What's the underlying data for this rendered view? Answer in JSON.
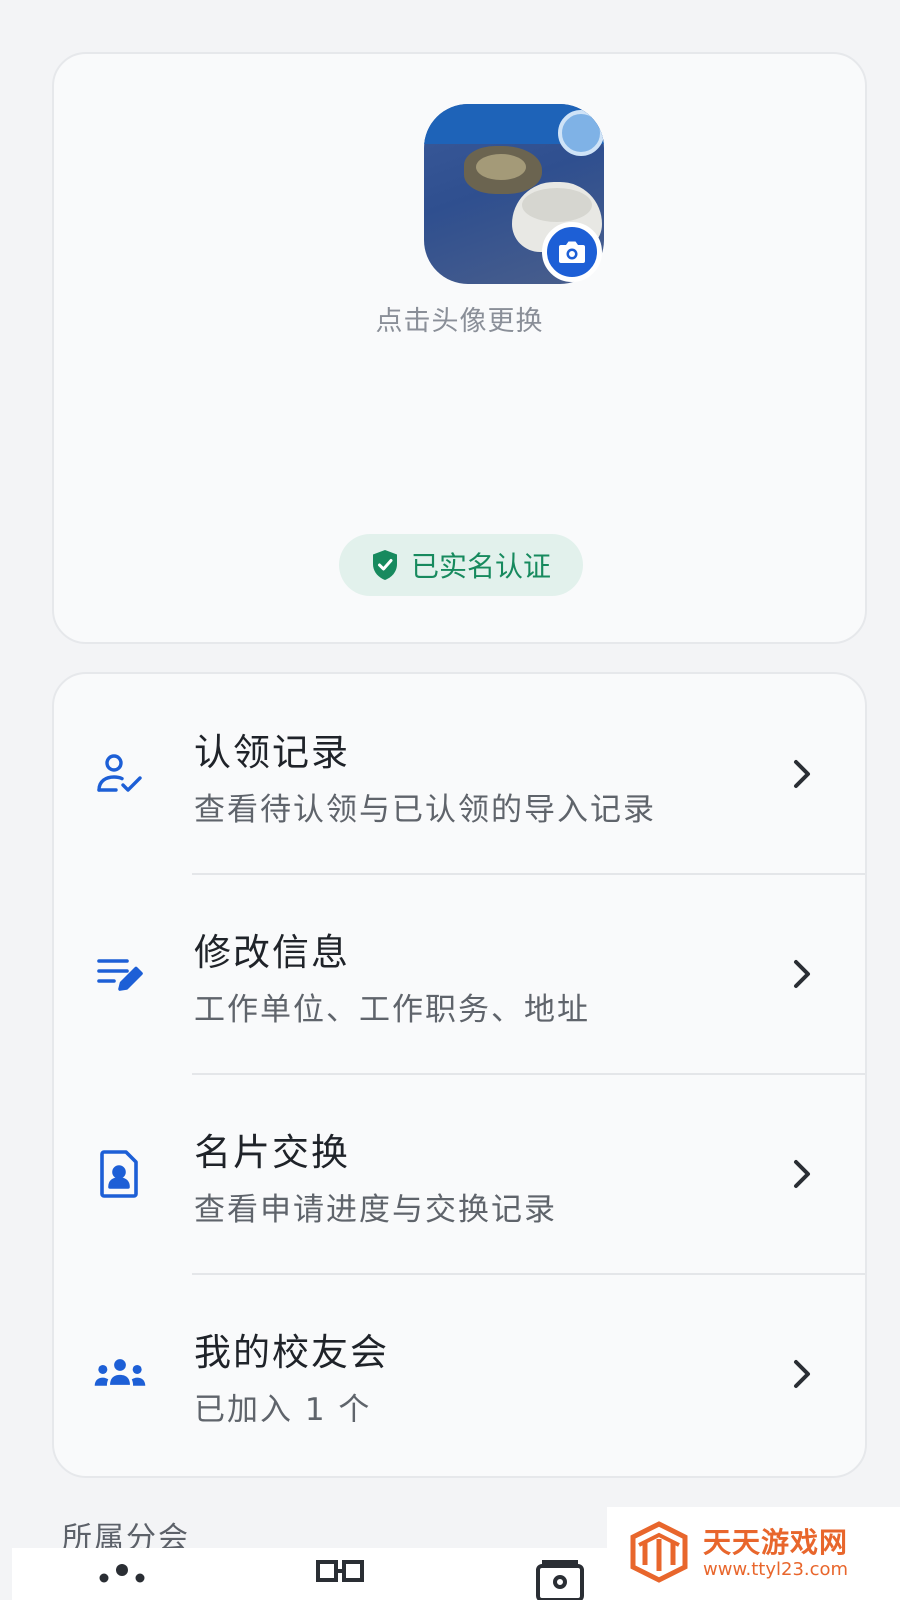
{
  "profile": {
    "change_avatar_hint": "点击头像更换",
    "verified_label": "已实名认证"
  },
  "menu": {
    "items": [
      {
        "title": "认领记录",
        "subtitle": "查看待认领与已认领的导入记录",
        "icon": "person-check-icon"
      },
      {
        "title": "修改信息",
        "subtitle": "工作单位、工作职务、地址",
        "icon": "edit-list-icon"
      },
      {
        "title": "名片交换",
        "subtitle": "查看申请进度与交换记录",
        "icon": "contact-card-icon"
      },
      {
        "title": "我的校友会",
        "subtitle": "已加入 1 个",
        "icon": "group-icon"
      }
    ]
  },
  "section": {
    "label": "所属分会"
  },
  "watermark": {
    "name": "天天游戏网",
    "url": "www.ttyl23.com"
  },
  "colors": {
    "accent": "#1d5fd6",
    "verified_green": "#178a5e",
    "verified_bg": "#e2f1ec",
    "watermark_orange": "#e8662c"
  }
}
